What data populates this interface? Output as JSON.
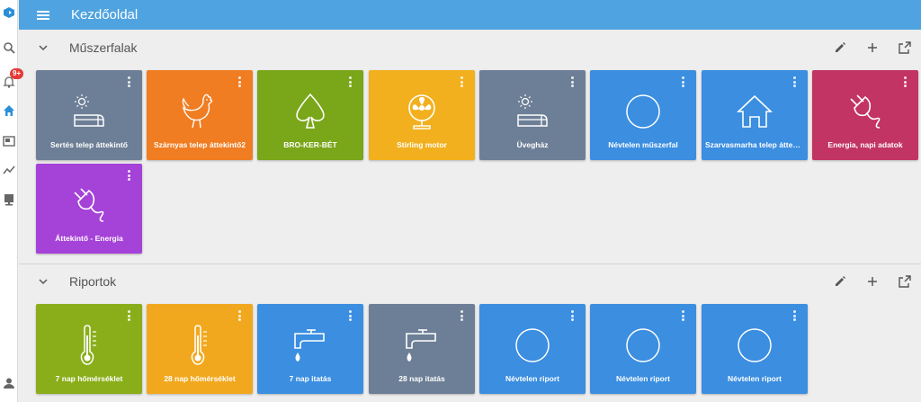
{
  "app": {
    "notification_count": "9+",
    "icons": [
      "app-logo-icon",
      "search-icon",
      "bell-icon",
      "home-icon",
      "dashboard-icon",
      "chart-icon",
      "device-icon",
      "user-icon"
    ]
  },
  "header": {
    "title": "Kezdőoldal"
  },
  "sections": [
    {
      "title": "Műszerfalak",
      "tiles": [
        {
          "label": "Sertés telep áttekintő",
          "color": "#6d7f96",
          "icon": "sun-barn-icon"
        },
        {
          "label": "Szárnyas telep áttekintő2",
          "color": "#f07d22",
          "icon": "chicken-icon"
        },
        {
          "label": "BRO-KER-BÉT",
          "color": "#7aa61a",
          "icon": "spade-icon"
        },
        {
          "label": "Stirling motor",
          "color": "#f2b01e",
          "icon": "fan-icon"
        },
        {
          "label": "Üvegház",
          "color": "#6d7f96",
          "icon": "sun-barn-icon"
        },
        {
          "label": "Névtelen műszerfal",
          "color": "#3b8ee0",
          "icon": "circle-icon"
        },
        {
          "label": "Szarvasmarha telep átteki...",
          "color": "#3b8ee0",
          "icon": "house-icon"
        },
        {
          "label": "Energia, napi adatok",
          "color": "#c23464",
          "icon": "plug-icon"
        },
        {
          "label": "Áttekintő - Energia",
          "color": "#a542d8",
          "icon": "plug-icon"
        }
      ]
    },
    {
      "title": "Riportok",
      "tiles": [
        {
          "label": "7 nap hőmérséklet",
          "color": "#8aae1a",
          "icon": "thermometer-icon"
        },
        {
          "label": "28 nap hőmérséklet",
          "color": "#f2a81e",
          "icon": "thermometer-icon"
        },
        {
          "label": "7 nap itatás",
          "color": "#3b8ee0",
          "icon": "faucet-icon"
        },
        {
          "label": "28 nap itatás",
          "color": "#6d7f96",
          "icon": "faucet-icon"
        },
        {
          "label": "Névtelen riport",
          "color": "#3b8ee0",
          "icon": "circle-icon"
        },
        {
          "label": "Névtelen riport",
          "color": "#3b8ee0",
          "icon": "circle-icon"
        },
        {
          "label": "Névtelen riport",
          "color": "#3b8ee0",
          "icon": "circle-icon"
        }
      ]
    }
  ]
}
